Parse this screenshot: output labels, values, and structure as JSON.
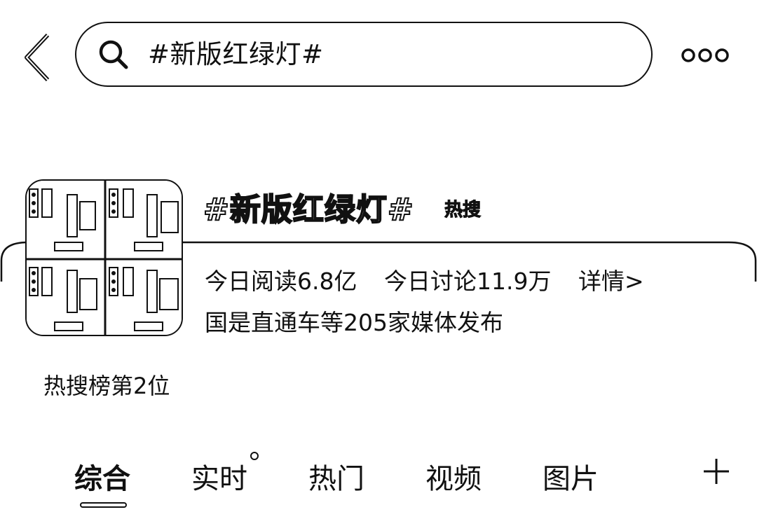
{
  "header": {
    "back_icon": "chevron-left-icon",
    "search_icon": "search-icon",
    "search_query": "#新版红绿灯#",
    "more_icon": "more-dots-icon"
  },
  "topic": {
    "title": "#新版红绿灯#",
    "badge": "热搜",
    "read_today": "今日阅读6.8亿",
    "discuss_today": "今日讨论11.9万",
    "detail_link": "详情>",
    "publishers": "国是直通车等205家媒体发布",
    "rank": "热搜榜第2位"
  },
  "tabs": [
    {
      "label": "综合",
      "active": true
    },
    {
      "label": "实时",
      "active": false
    },
    {
      "label": "热门",
      "active": false
    },
    {
      "label": "视频",
      "active": false
    },
    {
      "label": "图片",
      "active": false
    }
  ],
  "add_tab_icon": "plus-icon"
}
